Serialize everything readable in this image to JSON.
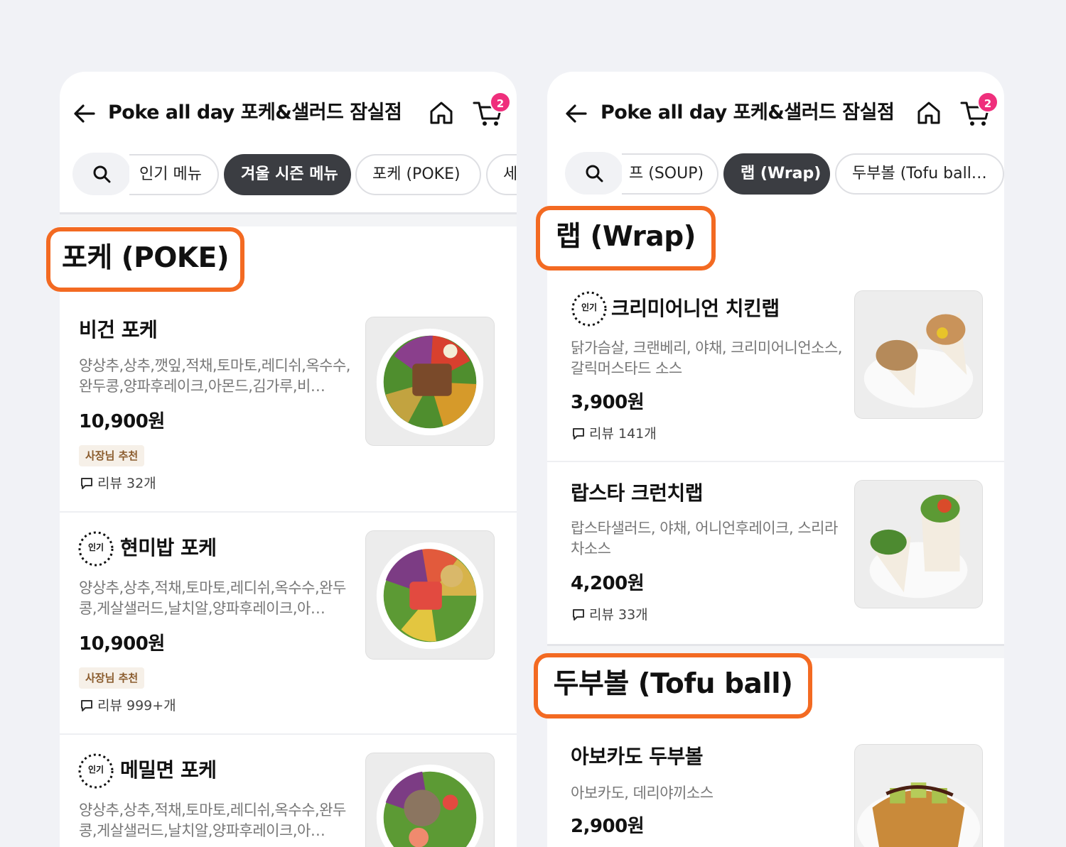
{
  "left": {
    "store_title": "Poke all day 포케&샐러드 잠실점",
    "cart_count": "2",
    "chips": [
      "인기 메뉴",
      "겨울 시즌 메뉴",
      "포케 (POKE)",
      "세"
    ],
    "section_label": "포케 (POKE)",
    "items": [
      {
        "name": "비건 포케",
        "desc": "양상추,상추,깻잎,적채,토마토,레디쉬,옥수수,완두콩,양파후레이크,아몬드,김가루,비…",
        "price": "10,900원",
        "badge": "사장님 추천",
        "review": "리뷰 32개"
      },
      {
        "name": "현미밥 포케",
        "desc": "양상추,상추,적채,토마토,레디쉬,옥수수,완두콩,게살샐러드,날치알,양파후레이크,아…",
        "price": "10,900원",
        "badge": "사장님 추천",
        "review": "리뷰 999+개"
      },
      {
        "name": "메밀면 포케",
        "desc": "양상추,상추,적채,토마토,레디쉬,옥수수,완두콩,게살샐러드,날치알,양파후레이크,아…"
      }
    ]
  },
  "right": {
    "store_title": "Poke all day 포케&샐러드 잠실점",
    "cart_count": "2",
    "chips": [
      "프 (SOUP)",
      "랩 (Wrap)",
      "두부볼 (Tofu ball…"
    ],
    "section_label_1": "랩 (Wrap)",
    "section_label_2": "두부볼 (Tofu ball)",
    "items": [
      {
        "name": "크리미어니언 치킨랩",
        "desc": "닭가슴살, 크랜베리, 야채, 크리미어니언소스, 갈릭머스타드 소스",
        "price": "3,900원",
        "review": "리뷰 141개"
      },
      {
        "name": "랍스타 크런치랩",
        "desc": "랍스타샐러드, 야채,  어니언후레이크, 스리라차소스",
        "price": "4,200원",
        "review": "리뷰 33개"
      },
      {
        "name": "아보카도 두부볼",
        "desc": "아보카도, 데리야끼소스",
        "price": "2,900원"
      }
    ]
  },
  "popular_label": "인기",
  "colors": {
    "accent_orange": "#f36a22",
    "badge_pink": "#ef2f7c",
    "active_chip": "#3b3d42"
  }
}
